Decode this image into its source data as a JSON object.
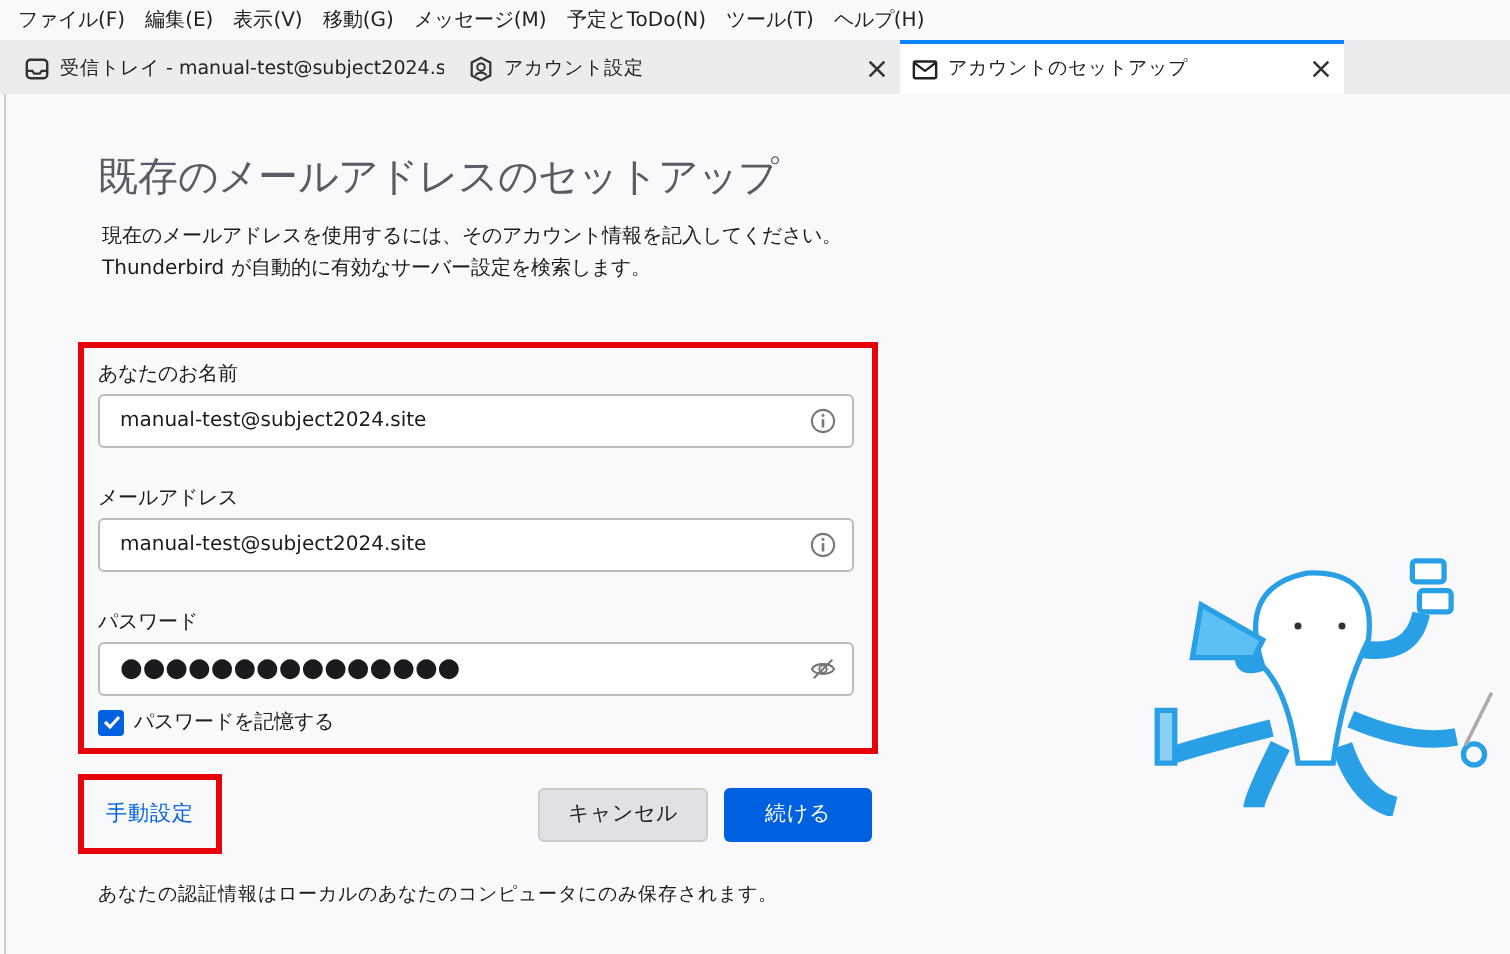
{
  "menu_bar": [
    "ファイル(F)",
    "編集(E)",
    "表示(V)",
    "移動(G)",
    "メッセージ(M)",
    "予定とToDo(N)",
    "ツール(T)",
    "ヘルプ(H)"
  ],
  "tabs": [
    {
      "label": "受信トレイ - manual-test@subject2024.s",
      "kind": "inbox",
      "selected": false,
      "closable": false
    },
    {
      "label": "アカウント設定",
      "kind": "settings",
      "selected": false,
      "closable": true
    },
    {
      "label": "アカウントのセットアップ",
      "kind": "setup",
      "selected": true,
      "closable": true
    }
  ],
  "page": {
    "title": "既存のメールアドレスのセットアップ",
    "description": [
      "現在のメールアドレスを使用するには、そのアカウント情報を記入してください。",
      "Thunderbird が自動的に有効なサーバー設定を検索します。"
    ]
  },
  "form": {
    "highlighted": true,
    "fields": [
      {
        "label": "あなたのお名前",
        "value": "manual-test@subject2024.site",
        "kind": "info"
      },
      {
        "label": "メールアドレス",
        "value": "manual-test@subject2024.site",
        "kind": "info"
      },
      {
        "label": "パスワード",
        "value": "●●●●●●●●●●●●●●●",
        "kind": "password"
      }
    ],
    "remember_password": {
      "label": "パスワードを記憶する",
      "checked": true
    }
  },
  "manual_config": {
    "label": "手動設定",
    "highlighted": true
  },
  "buttons": [
    {
      "label": "キャンセル",
      "kind": "secondary"
    },
    {
      "label": "続ける",
      "kind": "primary"
    }
  ],
  "footer": "あなたの認証情報はローカルのあなたのコンピュータにのみ保存されます。"
}
